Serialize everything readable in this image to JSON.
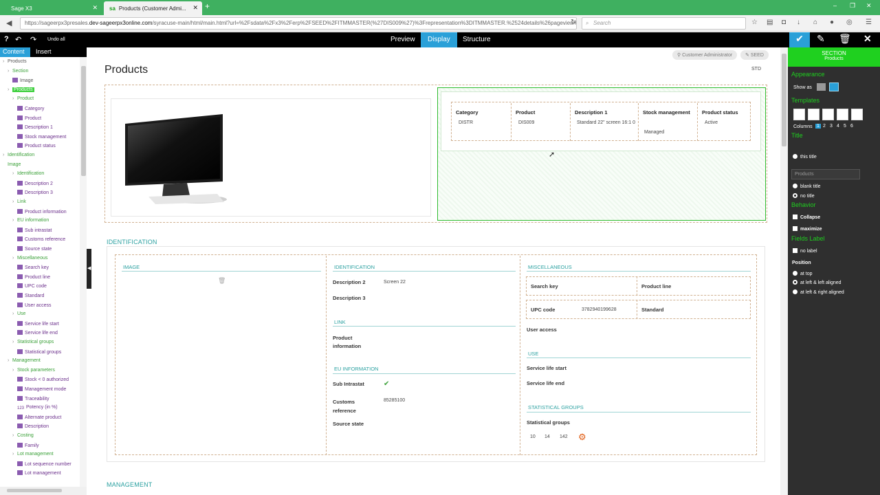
{
  "browser": {
    "tabs": [
      {
        "label": "Sage X3"
      },
      {
        "label": "Products (Customer Admi..."
      }
    ],
    "url_prefix": "https://sageerpx3presales.",
    "url_host": "dev-sageerpx3online.com",
    "url_rest": "/syracuse-main/html/main.html?url=%2Fsdata%2Fx3%2Ferp%2FSEED%2FITMMASTER(%27DIS009%27)%3Frepresentation%3DITMMASTER.%2524details%26pageview%3",
    "search_placeholder": "Search"
  },
  "appbar": {
    "undo_all": "Undo all",
    "content_tab": "Content",
    "insert_tab": "Insert",
    "modes": [
      "Preview",
      "Display",
      "Structure"
    ],
    "selected_mode": "Display"
  },
  "tree": [
    {
      "t": "Products",
      "c": "b",
      "d": 0,
      "ar": "›"
    },
    {
      "t": "Section",
      "c": "g",
      "d": 1,
      "ar": "›"
    },
    {
      "t": "Image",
      "c": "b",
      "d": 2,
      "sq": "p"
    },
    {
      "t": "Products",
      "c": "hl",
      "d": 1,
      "ar": "›"
    },
    {
      "t": "Product",
      "c": "g",
      "d": 2,
      "ar": "›"
    },
    {
      "t": "Category",
      "c": "p",
      "d": 3,
      "sq": "p"
    },
    {
      "t": "Product",
      "c": "p",
      "d": 3,
      "sq": "p"
    },
    {
      "t": "Description 1",
      "c": "p",
      "d": 3,
      "sq": "p"
    },
    {
      "t": "Stock management",
      "c": "p",
      "d": 3,
      "sq": "p"
    },
    {
      "t": "Product status",
      "c": "p",
      "d": 3,
      "sq": "p"
    },
    {
      "t": "Identification",
      "c": "g",
      "d": 0,
      "ar": "›"
    },
    {
      "t": "Image",
      "c": "g",
      "d": 1
    },
    {
      "t": "Identification",
      "c": "g",
      "d": 2,
      "ar": "›"
    },
    {
      "t": "Description 2",
      "c": "p",
      "d": 3,
      "sq": "p"
    },
    {
      "t": "Description 3",
      "c": "p",
      "d": 3,
      "sq": "p"
    },
    {
      "t": "Link",
      "c": "g",
      "d": 2,
      "ar": "›"
    },
    {
      "t": "Product information",
      "c": "p",
      "d": 3,
      "sq": "p"
    },
    {
      "t": "EU information",
      "c": "g",
      "d": 2,
      "ar": "›"
    },
    {
      "t": "Sub intrastat",
      "c": "p",
      "d": 3,
      "sq": "p"
    },
    {
      "t": "Customs reference",
      "c": "p",
      "d": 3,
      "sq": "p"
    },
    {
      "t": "Source state",
      "c": "p",
      "d": 3,
      "sq": "p"
    },
    {
      "t": "Miscellaneous",
      "c": "g",
      "d": 2,
      "ar": "›"
    },
    {
      "t": "Search key",
      "c": "p",
      "d": 3,
      "sq": "p"
    },
    {
      "t": "Product line",
      "c": "p",
      "d": 3,
      "sq": "p"
    },
    {
      "t": "UPC code",
      "c": "p",
      "d": 3,
      "sq": "p"
    },
    {
      "t": "Standard",
      "c": "p",
      "d": 3,
      "sq": "p"
    },
    {
      "t": "User access",
      "c": "p",
      "d": 3,
      "sq": "p"
    },
    {
      "t": "Use",
      "c": "g",
      "d": 2,
      "ar": "›"
    },
    {
      "t": "Service life start",
      "c": "p",
      "d": 3,
      "sq": "p"
    },
    {
      "t": "Service life end",
      "c": "p",
      "d": 3,
      "sq": "p"
    },
    {
      "t": "Statistical groups",
      "c": "g",
      "d": 2,
      "ar": "›"
    },
    {
      "t": "Statistical groups",
      "c": "p",
      "d": 3,
      "sq": "p"
    },
    {
      "t": "Management",
      "c": "g",
      "d": 1,
      "ar": "›"
    },
    {
      "t": "Stock parameters",
      "c": "g",
      "d": 2,
      "ar": "›"
    },
    {
      "t": "Stock < 0 authorized",
      "c": "p",
      "d": 3,
      "sq": "p"
    },
    {
      "t": "Management mode",
      "c": "p",
      "d": 3,
      "sq": "p"
    },
    {
      "t": "Traceability",
      "c": "p",
      "d": 3,
      "sq": "p"
    },
    {
      "t": "Potency (in %)",
      "c": "p",
      "d": 3,
      "sq": "n"
    },
    {
      "t": "Alternate product",
      "c": "p",
      "d": 3,
      "sq": "p"
    },
    {
      "t": "Description",
      "c": "p",
      "d": 3,
      "sq": "p"
    },
    {
      "t": "Costing",
      "c": "g",
      "d": 2,
      "ar": "›"
    },
    {
      "t": "Family",
      "c": "p",
      "d": 3,
      "sq": "p"
    },
    {
      "t": "Lot management",
      "c": "g",
      "d": 2,
      "ar": "›"
    },
    {
      "t": "Lot sequence number",
      "c": "p",
      "d": 3,
      "sq": "p"
    },
    {
      "t": "Lot management",
      "c": "p",
      "d": 3,
      "sq": "p"
    }
  ],
  "page": {
    "title": "Products",
    "role_badge": "Customer Administrator",
    "folder_badge": "SEED",
    "std": "STD",
    "header_cols": [
      {
        "h": "Category",
        "v": "DISTR"
      },
      {
        "h": "Product",
        "v": "DIS009"
      },
      {
        "h": "Description 1",
        "v": "Standard 22\" screen 16:1 0"
      },
      {
        "h": "Stock management",
        "v": "Managed"
      },
      {
        "h": "Product status",
        "v": "Active"
      }
    ],
    "identification_title": "IDENTIFICATION",
    "image_sub": "IMAGE",
    "ident_sub": "IDENTIFICATION",
    "desc2_label": "Description 2",
    "desc2_value": "Screen 22",
    "desc3_label": "Description 3",
    "link_sub": "LINK",
    "prodinfo_label": "Product information",
    "eu_sub": "EU INFORMATION",
    "subintra_label": "Sub Intrastat",
    "customs_label": "Customs reference",
    "customs_value": "85285100",
    "source_label": "Source state",
    "misc_sub": "MISCELLANEOUS",
    "searchkey_label": "Search key",
    "prodline_label": "Product line",
    "upc_label": "UPC code",
    "upc_value": "3782940199628",
    "standard_label": "Standard",
    "useraccess_label": "User access",
    "use_sub": "USE",
    "svcstart_label": "Service life start",
    "svcend_label": "Service life end",
    "stat_sub": "STATISTICAL GROUPS",
    "statgroups_label": "Statistical groups",
    "stat_values": [
      "10",
      "14",
      "142"
    ],
    "management_title": "MANAGEMENT"
  },
  "panel": {
    "section_label": "SECTION",
    "section_sub": "Products",
    "appearance": "Appearance",
    "show_as": "Show as",
    "templates": "Templates",
    "columns_label": "Columns",
    "columns": [
      "1",
      "2",
      "3",
      "4",
      "5",
      "6"
    ],
    "columns_selected": "1",
    "title_head": "Title",
    "this_title": "this title",
    "title_placeholder": "Products",
    "blank_title": "blank title",
    "no_title": "no title",
    "behavior": "Behavior",
    "collapse": "Collapse",
    "maximize": "maximize",
    "fields_label": "Fields Label",
    "no_label": "no label",
    "position": "Position",
    "at_top": "at top",
    "at_left_left": "at left & left aligned",
    "at_left_right": "at left & right aligned"
  },
  "colors": {
    "accent_green": "#1fd01f",
    "accent_blue": "#2aa0d8",
    "tree_purple": "#6b2f8b",
    "section_teal": "#2aa0a0"
  }
}
